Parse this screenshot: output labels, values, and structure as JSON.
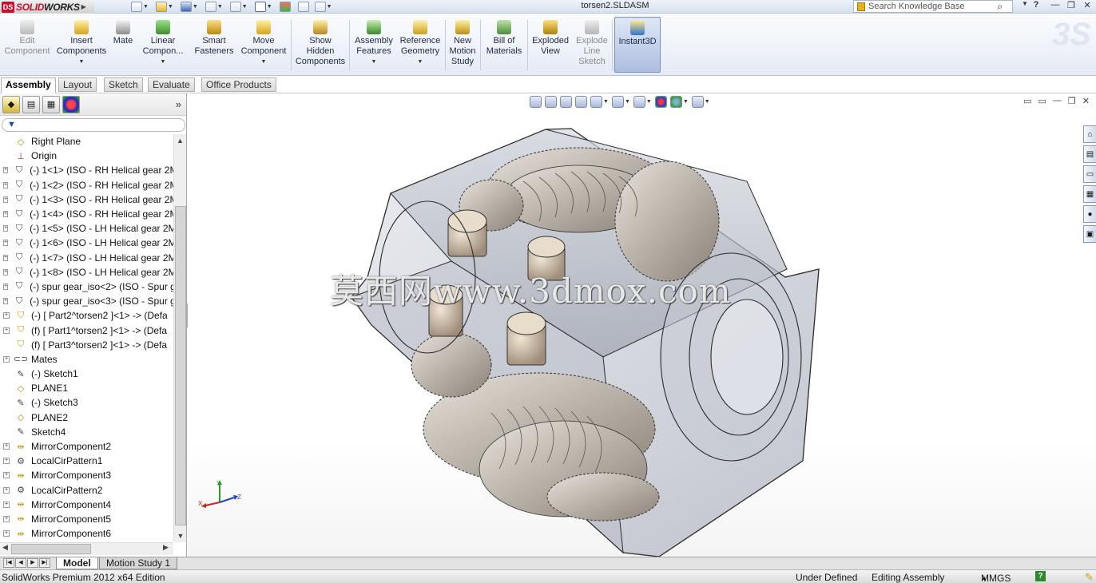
{
  "app": {
    "brand_prefix": "SOLID",
    "brand_suffix": "WORKS",
    "logo_text": "DS",
    "document_title": "torsen2.SLDASM"
  },
  "search": {
    "placeholder": "Search Knowledge Base"
  },
  "window_controls": {
    "help": "?",
    "minimize": "—",
    "restore": "❐",
    "close": "✕"
  },
  "commands": [
    {
      "label": "Edit\nComponent",
      "icon": "edit-component-icon",
      "enabled": false
    },
    {
      "label": "Insert\nComponents",
      "icon": "insert-components-icon",
      "enabled": true
    },
    {
      "label": "Mate",
      "icon": "mate-icon",
      "enabled": true
    },
    {
      "label": "Linear\nCompon...",
      "icon": "linear-pattern-icon",
      "enabled": true
    },
    {
      "label": "Smart\nFasteners",
      "icon": "smart-fasteners-icon",
      "enabled": true
    },
    {
      "label": "Move\nComponent",
      "icon": "move-component-icon",
      "enabled": true
    },
    {
      "label": "Show\nHidden\nComponents",
      "icon": "show-hidden-icon",
      "enabled": true
    },
    {
      "label": "Assembly\nFeatures",
      "icon": "assembly-features-icon",
      "enabled": true
    },
    {
      "label": "Reference\nGeometry",
      "icon": "reference-geometry-icon",
      "enabled": true
    },
    {
      "label": "New\nMotion\nStudy",
      "icon": "motion-study-icon",
      "enabled": true
    },
    {
      "label": "Bill of\nMaterials",
      "icon": "bom-icon",
      "enabled": true
    },
    {
      "label": "Exploded\nView",
      "icon": "exploded-view-icon",
      "enabled": true
    },
    {
      "label": "Explode\nLine\nSketch",
      "icon": "explode-line-icon",
      "enabled": false
    },
    {
      "label": "Instant3D",
      "icon": "instant3d-icon",
      "enabled": true,
      "active": true
    }
  ],
  "tabs": [
    "Assembly",
    "Layout",
    "Sketch",
    "Evaluate",
    "Office Products"
  ],
  "active_tab": "Assembly",
  "feature_tree": {
    "filter_symbol": "▼",
    "expand_symbol": "»",
    "items": [
      {
        "label": "Right Plane",
        "icon": "plane-icon",
        "expandable": false
      },
      {
        "label": "Origin",
        "icon": "origin-icon",
        "expandable": false
      },
      {
        "label": "(-) 1<1> (ISO - RH Helical gear 2M",
        "icon": "part-icon",
        "expandable": true
      },
      {
        "label": "(-) 1<2> (ISO - RH Helical gear 2M",
        "icon": "part-icon",
        "expandable": true
      },
      {
        "label": "(-) 1<3> (ISO - RH Helical gear 2M",
        "icon": "part-icon",
        "expandable": true
      },
      {
        "label": "(-) 1<4> (ISO - RH Helical gear 2M",
        "icon": "part-icon",
        "expandable": true
      },
      {
        "label": "(-) 1<5> (ISO - LH Helical gear 2M",
        "icon": "part-icon",
        "expandable": true
      },
      {
        "label": "(-) 1<6> (ISO - LH Helical gear 2M",
        "icon": "part-icon",
        "expandable": true
      },
      {
        "label": "(-) 1<7> (ISO - LH Helical gear 2M",
        "icon": "part-icon",
        "expandable": true
      },
      {
        "label": "(-) 1<8> (ISO - LH Helical gear 2M",
        "icon": "part-icon",
        "expandable": true
      },
      {
        "label": "(-) spur gear_iso<2> (ISO - Spur g",
        "icon": "part-icon",
        "expandable": true
      },
      {
        "label": "(-) spur gear_iso<3> (ISO - Spur g",
        "icon": "part-icon",
        "expandable": true
      },
      {
        "label": "(-) [ Part2^torsen2 ]<1> -> (Defa",
        "icon": "virtual-part-icon",
        "expandable": true
      },
      {
        "label": "(f) [ Part1^torsen2 ]<1> -> (Defa",
        "icon": "virtual-part-icon",
        "expandable": true
      },
      {
        "label": "(f) [ Part3^torsen2 ]<1> -> (Defa",
        "icon": "virtual-part-icon",
        "expandable": false
      },
      {
        "label": "Mates",
        "icon": "mates-icon",
        "expandable": true
      },
      {
        "label": "(-) Sketch1",
        "icon": "sketch-icon",
        "expandable": false
      },
      {
        "label": "PLANE1",
        "icon": "plane-icon",
        "expandable": false
      },
      {
        "label": "(-) Sketch3",
        "icon": "sketch-icon",
        "expandable": false
      },
      {
        "label": "PLANE2",
        "icon": "plane-icon",
        "expandable": false
      },
      {
        "label": "Sketch4",
        "icon": "sketch-icon",
        "expandable": false
      },
      {
        "label": "MirrorComponent2",
        "icon": "mirror-component-icon",
        "expandable": true
      },
      {
        "label": "LocalCirPattern1",
        "icon": "circular-pattern-icon",
        "expandable": true
      },
      {
        "label": "MirrorComponent3",
        "icon": "mirror-component-icon",
        "expandable": true
      },
      {
        "label": "LocalCirPattern2",
        "icon": "circular-pattern-icon",
        "expandable": true
      },
      {
        "label": "MirrorComponent4",
        "icon": "mirror-component-icon",
        "expandable": true
      },
      {
        "label": "MirrorComponent5",
        "icon": "mirror-component-icon",
        "expandable": true
      },
      {
        "label": "MirrorComponent6",
        "icon": "mirror-component-icon",
        "expandable": true
      }
    ]
  },
  "viewport": {
    "watermark": "莫西网www.3dmox.com",
    "triad": {
      "x": "X",
      "y": "Y",
      "z": "Z"
    },
    "colors": {
      "housing": "#c5c9d3",
      "gear": "#b8b1a8",
      "edge": "#2a2a2a",
      "pin": "#d2c4b2"
    }
  },
  "bottom_tabs": [
    "Model",
    "Motion Study 1"
  ],
  "active_bottom_tab": "Model",
  "status": {
    "edition": "SolidWorks Premium 2012 x64 Edition",
    "state": "Under Defined",
    "mode": "Editing Assembly",
    "units": "MMGS",
    "units_arrow": "▲",
    "help": "?"
  }
}
